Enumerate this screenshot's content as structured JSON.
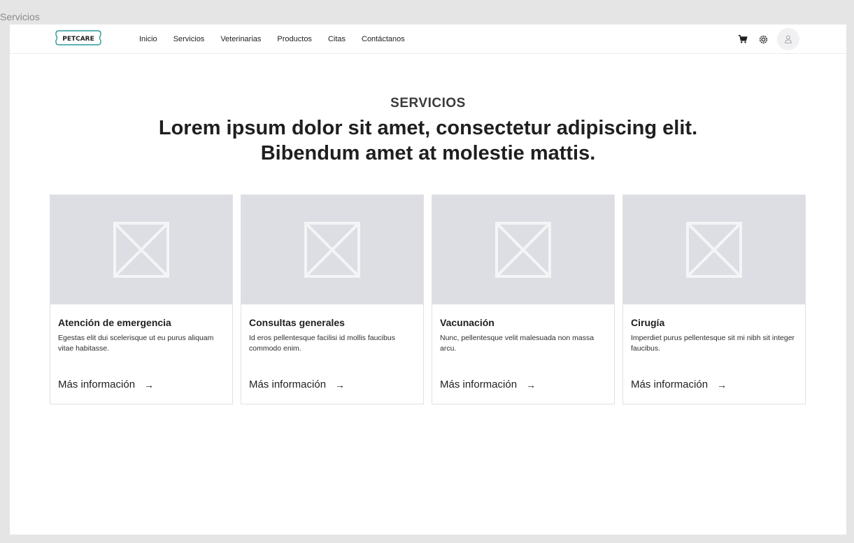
{
  "frame_label": "Servicios",
  "nav": {
    "logo_text": "PETCARE",
    "links": [
      "Inicio",
      "Servicios",
      "Veterinarias",
      "Productos",
      "Citas",
      "Contáctanos"
    ],
    "icons": {
      "cart": "cart-icon",
      "settings": "gear-icon",
      "user": "user-icon"
    }
  },
  "hero": {
    "eyebrow": "SERVICIOS",
    "headline_line1": "Lorem ipsum dolor sit amet, consectetur adipiscing elit.",
    "headline_line2": "Bibendum amet at molestie mattis."
  },
  "cards": [
    {
      "title": "Atención de emergencia",
      "description": "Egestas elit dui scelerisque ut eu purus aliquam vitae habitasse.",
      "link": "Más información"
    },
    {
      "title": "Consultas generales",
      "description": "Id eros pellentesque facilisi id mollis faucibus commodo enim.",
      "link": "Más información"
    },
    {
      "title": "Vacunación",
      "description": "Nunc, pellentesque velit malesuada non massa arcu.",
      "link": "Más información"
    },
    {
      "title": "Cirugía",
      "description": "Imperdiet purus pellentesque sit mi nibh sit integer faucibus.",
      "link": "Más información"
    }
  ],
  "colors": {
    "background": "#e5e5e5",
    "surface": "#ffffff",
    "placeholder": "#dcdee3",
    "logo_accent": "#2b9a9a"
  }
}
